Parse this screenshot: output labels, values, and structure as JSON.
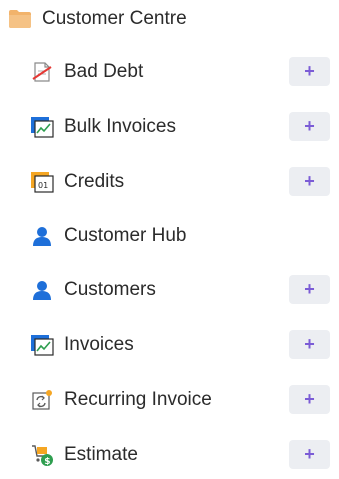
{
  "header": {
    "title": "Customer Centre",
    "icon": "folder-icon",
    "folder_color": "#f2b36b"
  },
  "accent_color": "#7b5cd6",
  "add_button_bg": "#eceef2",
  "items": [
    {
      "label": "Bad Debt",
      "icon": "bad-debt-icon",
      "add_label": "+"
    },
    {
      "label": "Bulk Invoices",
      "icon": "bulk-invoices-icon",
      "add_label": "+"
    },
    {
      "label": "Credits",
      "icon": "credits-icon",
      "add_label": "+"
    },
    {
      "label": "Customer Hub",
      "icon": "customer-hub-icon"
    },
    {
      "label": "Customers",
      "icon": "customers-icon",
      "add_label": "+"
    },
    {
      "label": "Invoices",
      "icon": "invoices-icon",
      "add_label": "+"
    },
    {
      "label": "Recurring Invoice",
      "icon": "recurring-invoice-icon",
      "add_label": "+"
    },
    {
      "label": "Estimate",
      "icon": "estimate-icon",
      "add_label": "+"
    }
  ]
}
